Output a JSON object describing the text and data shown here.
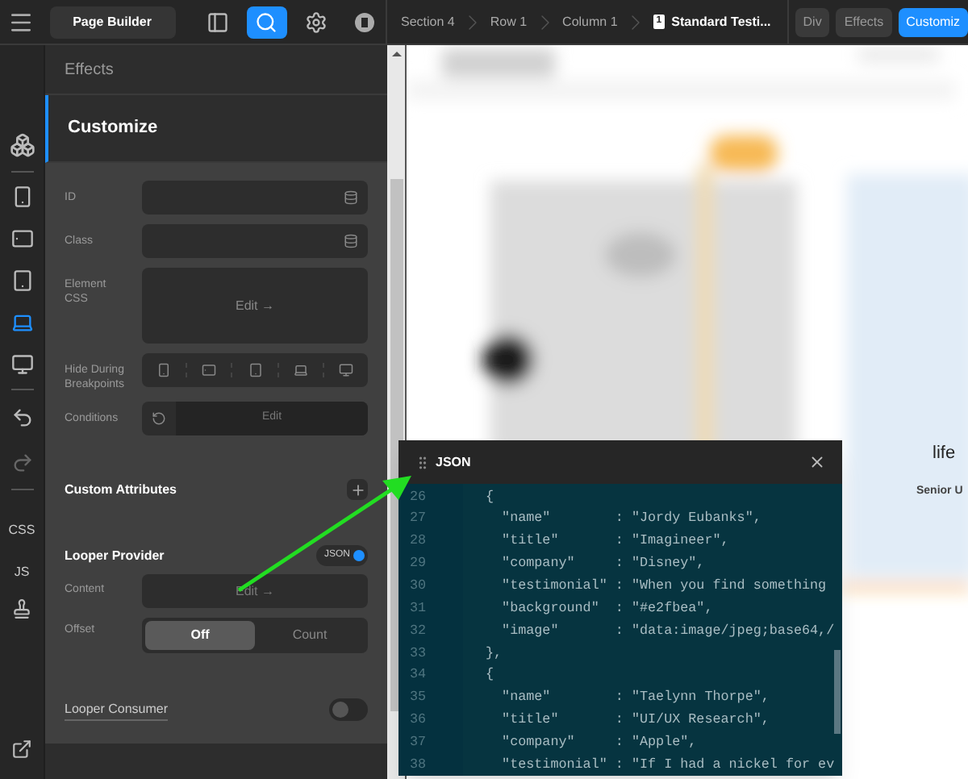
{
  "top_bar": {
    "title_button": "Page Builder",
    "tools": [
      {
        "kind": "panel",
        "selected": false
      },
      {
        "kind": "search",
        "selected": true
      },
      {
        "kind": "settings",
        "selected": false
      },
      {
        "kind": "badge",
        "selected": false
      }
    ],
    "breadcrumbs": [
      {
        "label": "Section 4",
        "numbered": false
      },
      {
        "label": "Row 1",
        "numbered": false
      },
      {
        "label": "Column 1",
        "numbered": false
      },
      {
        "label": "Standard Testi...",
        "numbered": true,
        "number": "1"
      }
    ],
    "element_tabs": [
      {
        "label": "Div",
        "selected": false
      },
      {
        "label": "Effects",
        "selected": false
      },
      {
        "label": "Customiz",
        "selected": true
      }
    ]
  },
  "rail": {
    "devices": [
      {
        "kind": "phone",
        "selected": false
      },
      {
        "kind": "tablet-landscape",
        "selected": false
      },
      {
        "kind": "tablet",
        "selected": false
      },
      {
        "kind": "laptop",
        "selected": true
      },
      {
        "kind": "desktop",
        "selected": false
      }
    ],
    "code_buttons": [
      "CSS",
      "JS"
    ]
  },
  "panel": {
    "sections": [
      {
        "label": "Effects",
        "selected": false
      },
      {
        "label": "Customize",
        "selected": true
      }
    ],
    "fields": [
      {
        "kind": "input",
        "label": "ID"
      },
      {
        "kind": "input",
        "label": "Class"
      },
      {
        "kind": "editor",
        "label": "Element CSS",
        "action": "Edit →"
      },
      {
        "kind": "breakpoints",
        "label": "Hide During Breakpoints"
      },
      {
        "kind": "conditions",
        "label": "Conditions",
        "action": "Edit"
      }
    ],
    "custom_attributes": "Custom Attributes",
    "looper_provider": {
      "label": "Looper Provider",
      "toggle_label": "JSON",
      "on": true,
      "content_label": "Content",
      "content_action": "Edit →",
      "offset_label": "Offset",
      "offset_options": [
        {
          "label": "Off",
          "selected": true
        },
        {
          "label": "Count",
          "selected": false
        }
      ]
    },
    "looper_consumer": {
      "label": "Looper Consumer",
      "on": false
    }
  },
  "json_editor": {
    "title": "JSON",
    "lines": [
      {
        "number": "26",
        "code": "{"
      },
      {
        "number": "27",
        "code": "  \"name\"        : \"Jordy Eubanks\","
      },
      {
        "number": "28",
        "code": "  \"title\"       : \"Imagineer\","
      },
      {
        "number": "29",
        "code": "  \"company\"     : \"Disney\","
      },
      {
        "number": "30",
        "code": "  \"testimonial\" : \"When you find something"
      },
      {
        "number": "31",
        "code": "  \"background\"  : \"#e2fbea\","
      },
      {
        "number": "32",
        "code": "  \"image\"       : \"data:image/jpeg;base64,/"
      },
      {
        "number": "33",
        "code": "},"
      },
      {
        "number": "34",
        "code": "{"
      },
      {
        "number": "35",
        "code": "  \"name\"        : \"Taelynn Thorpe\","
      },
      {
        "number": "36",
        "code": "  \"title\"       : \"UI/UX Research\","
      },
      {
        "number": "37",
        "code": "  \"company\"     : \"Apple\","
      },
      {
        "number": "38",
        "code": "  \"testimonial\" : \"If I had a nickel for ev"
      }
    ]
  },
  "preview": {
    "heading": "life",
    "caption": "Senior U"
  }
}
